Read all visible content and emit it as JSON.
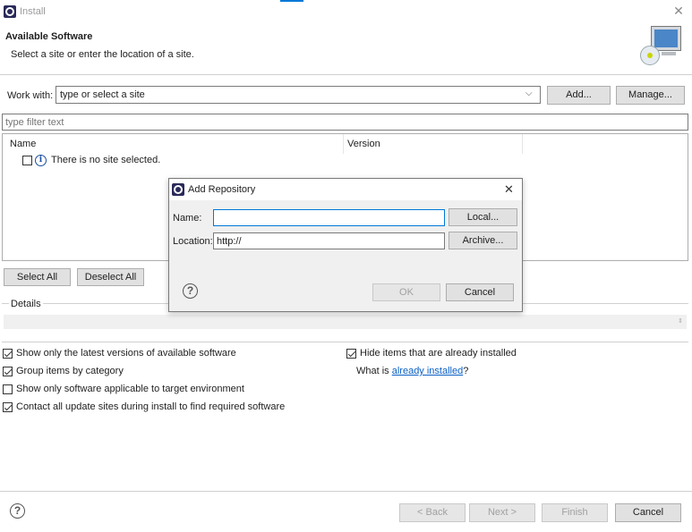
{
  "window": {
    "title": "Install"
  },
  "header": {
    "title": "Available Software",
    "subtitle": "Select a site or enter the location of a site."
  },
  "work_with": {
    "label": "Work with:",
    "value": "type or select a site",
    "add_label": "Add...",
    "manage_label": "Manage..."
  },
  "filter": {
    "placeholder": "type filter text"
  },
  "table": {
    "col_name": "Name",
    "col_version": "Version",
    "empty_message": "There is no site selected."
  },
  "buttons": {
    "select_all": "Select All",
    "deselect_all": "Deselect All",
    "back": "< Back",
    "next": "Next >",
    "finish": "Finish",
    "cancel": "Cancel"
  },
  "details": {
    "label": "Details"
  },
  "options": {
    "latest_versions": {
      "label": "Show only the latest versions of available software",
      "checked": true
    },
    "group_by_category": {
      "label": "Group items by category",
      "checked": true
    },
    "target_env": {
      "label": "Show only software applicable to target environment",
      "checked": false
    },
    "contact_sites": {
      "label": "Contact all update sites during install to find required software",
      "checked": true
    },
    "hide_installed": {
      "label": "Hide items that are already installed",
      "checked": true
    },
    "what_is_prefix": "What is ",
    "what_is_link": "already installed",
    "what_is_suffix": "?"
  },
  "dialog": {
    "title": "Add Repository",
    "name_label": "Name:",
    "name_value": "",
    "location_label": "Location:",
    "location_value": "http://",
    "local_label": "Local...",
    "archive_label": "Archive...",
    "ok_label": "OK",
    "cancel_label": "Cancel"
  },
  "colors": {
    "accent": "#0078d7",
    "link": "#0b5fc4",
    "button_bg": "#e1e1e1"
  }
}
